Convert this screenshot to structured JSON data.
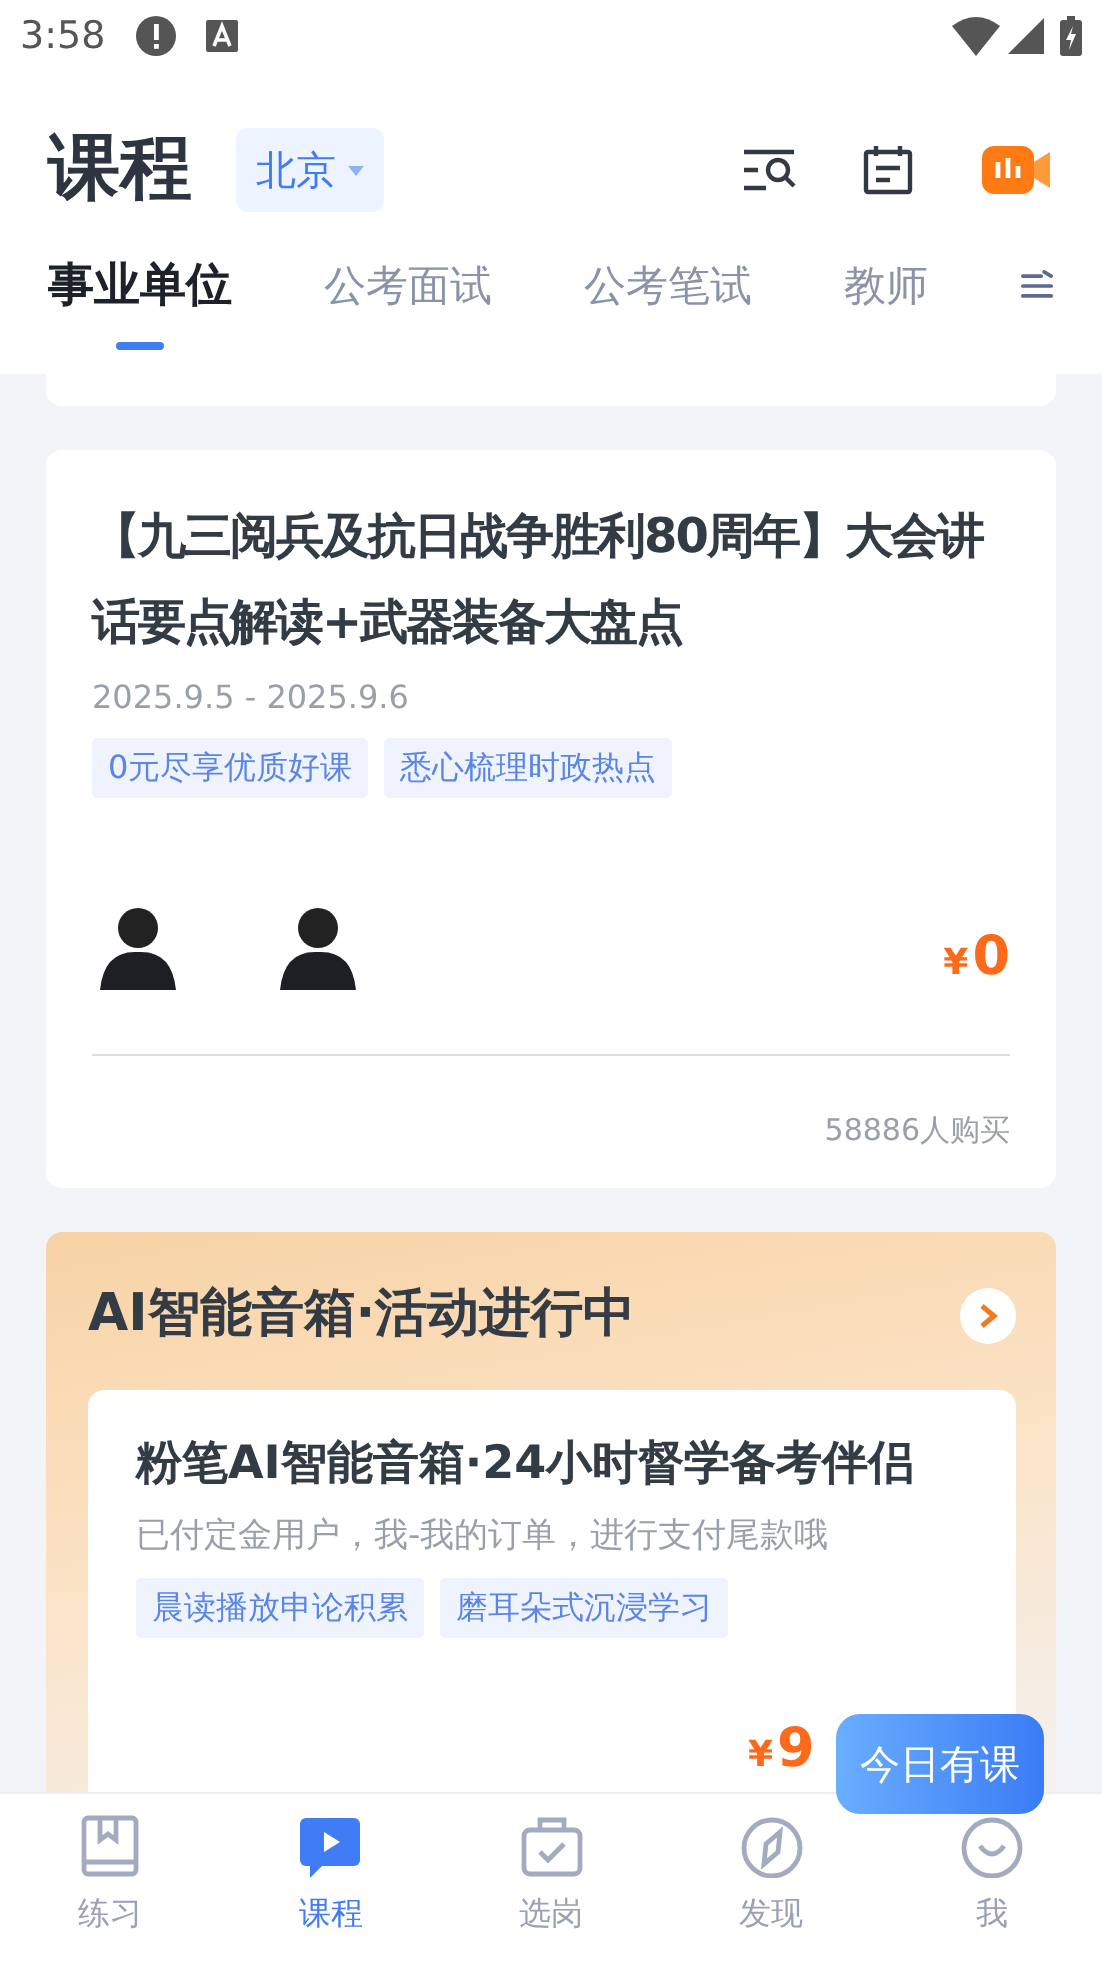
{
  "status_bar": {
    "time": "3:58"
  },
  "header": {
    "title": "课程",
    "city": "北京"
  },
  "tabs": [
    {
      "label": "事业单位",
      "selected": true
    },
    {
      "label": "公考面试",
      "selected": false
    },
    {
      "label": "公考笔试",
      "selected": false
    },
    {
      "label": "教师",
      "selected": false
    }
  ],
  "course": {
    "title": "【九三阅兵及抗日战争胜利80周年】大会讲话要点解读+武器装备大盘点",
    "date": "2025.9.5 - 2025.9.6",
    "tags": [
      "0元尽享优质好课",
      "悉心梳理时政热点"
    ],
    "currency": "¥",
    "price": "0",
    "sold": "58886人购买"
  },
  "promo": {
    "title": "AI智能音箱·活动进行中",
    "item": {
      "title": "粉笔AI智能音箱·24小时督学备考伴侣",
      "subtitle": "已付定金用户，我-我的订单，进行支付尾款哦",
      "tags": [
        "晨读播放申论积累",
        "磨耳朵式沉浸学习"
      ],
      "currency": "¥",
      "price": "9"
    }
  },
  "floating_badge": "今日有课",
  "bottom_nav": [
    {
      "kind": "book",
      "label": "练习",
      "selected": false
    },
    {
      "kind": "play",
      "label": "课程",
      "selected": true
    },
    {
      "kind": "case",
      "label": "选岗",
      "selected": false
    },
    {
      "kind": "compass",
      "label": "发现",
      "selected": false
    },
    {
      "kind": "smile",
      "label": "我",
      "selected": false
    }
  ]
}
